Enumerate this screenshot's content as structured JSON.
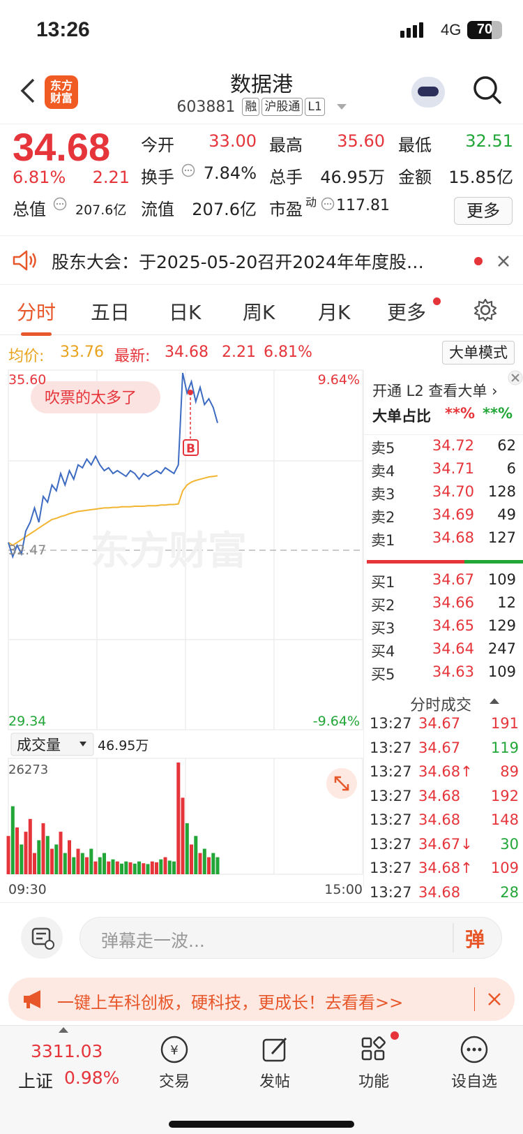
{
  "status": {
    "time": "13:26",
    "network": "4G",
    "battery": "70"
  },
  "header": {
    "title": "数据港",
    "code": "603881",
    "tags": [
      "融",
      "沪股通",
      "L1"
    ],
    "logo": "东方财富"
  },
  "quote": {
    "price": "34.68",
    "pct": "6.81%",
    "change": "2.21",
    "open_label": "今开",
    "open": "33.00",
    "high_label": "最高",
    "high": "35.60",
    "low_label": "最低",
    "low": "32.51",
    "turnover_label": "换手",
    "turnover": "7.84%",
    "vol_label": "总手",
    "vol": "46.95万",
    "amount_label": "金额",
    "amount": "15.85亿",
    "mcap_label": "总值",
    "mcap": "207.6亿",
    "float_label": "流值",
    "float": "207.6亿",
    "pe_label": "市盈",
    "pe_sup": "动",
    "pe": "117.81",
    "more": "更多"
  },
  "notice": {
    "text": "股东大会：于2025-05-20召开2024年年度股…"
  },
  "tabs": [
    "分时",
    "五日",
    "日K",
    "周K",
    "月K",
    "更多"
  ],
  "pricebar": {
    "avg_label": "均价:",
    "avg": "33.76",
    "latest_label": "最新:",
    "latest": "34.68",
    "change": "2.21",
    "pct": "6.81%",
    "mode_btn": "大单模式"
  },
  "chart": {
    "top": "35.60",
    "top_pct": "9.64%",
    "bottom": "29.34",
    "bottom_pct": "-9.64%",
    "prev": "32.47",
    "bubble": "吹票的太多了",
    "b_marker": "B",
    "watermark": "东方财富",
    "vol_dropdown": "成交量",
    "vol_total": "46.95万",
    "vol_max": "26273",
    "start": "09:30",
    "end": "15:00"
  },
  "chart_data": {
    "type": "line",
    "ylim": [
      29.34,
      35.6
    ],
    "prev_close": 32.47,
    "price": [
      32.6,
      32.35,
      32.55,
      32.4,
      32.8,
      32.95,
      33.2,
      32.95,
      33.4,
      33.3,
      33.6,
      33.5,
      33.8,
      33.6,
      33.85,
      33.7,
      33.95,
      33.9,
      34.05,
      33.95,
      34.1,
      33.95,
      33.85,
      33.9,
      33.8,
      33.85,
      33.8,
      33.75,
      33.85,
      33.8,
      33.7,
      33.8,
      33.75,
      33.8,
      33.85,
      33.8,
      33.9,
      33.85,
      33.8,
      33.95,
      35.55,
      35.2,
      35.4,
      35.05,
      35.3,
      35.0,
      35.1,
      34.95,
      34.68
    ],
    "avg": [
      32.6,
      32.55,
      32.6,
      32.65,
      32.7,
      32.75,
      32.8,
      32.85,
      32.9,
      32.95,
      33.0,
      33.02,
      33.05,
      33.07,
      33.1,
      33.12,
      33.14,
      33.15,
      33.16,
      33.17,
      33.18,
      33.19,
      33.2,
      33.2,
      33.21,
      33.21,
      33.22,
      33.22,
      33.22,
      33.23,
      33.23,
      33.23,
      33.24,
      33.24,
      33.24,
      33.25,
      33.25,
      33.26,
      33.26,
      33.27,
      33.5,
      33.6,
      33.65,
      33.68,
      33.7,
      33.72,
      33.74,
      33.75,
      33.76
    ],
    "volume": [
      9000,
      16000,
      11000,
      7000,
      10000,
      13000,
      5000,
      8000,
      12000,
      9000,
      6000,
      7000,
      10000,
      5000,
      8000,
      4000,
      6000,
      5000,
      4000,
      6000,
      3000,
      4000,
      5000,
      3000,
      3500,
      3000,
      2500,
      3000,
      2800,
      2500,
      3000,
      2600,
      2400,
      3000,
      2800,
      3500,
      4000,
      3200,
      3000,
      26273,
      18000,
      12000,
      7000,
      9000,
      5000,
      6000,
      4000,
      5000,
      4000
    ]
  },
  "bigorder": {
    "open_l2": "开通 L2 查看大单",
    "share_label": "大单占比",
    "buy": "**%",
    "sell": "**%"
  },
  "asks": [
    {
      "k": "卖5",
      "p": "34.72",
      "v": "62"
    },
    {
      "k": "卖4",
      "p": "34.71",
      "v": "6"
    },
    {
      "k": "卖3",
      "p": "34.70",
      "v": "128"
    },
    {
      "k": "卖2",
      "p": "34.69",
      "v": "49"
    },
    {
      "k": "卖1",
      "p": "34.68",
      "v": "127"
    }
  ],
  "bids": [
    {
      "k": "买1",
      "p": "34.67",
      "v": "109"
    },
    {
      "k": "买2",
      "p": "34.66",
      "v": "12"
    },
    {
      "k": "买3",
      "p": "34.65",
      "v": "129"
    },
    {
      "k": "买4",
      "p": "34.64",
      "v": "247"
    },
    {
      "k": "买5",
      "p": "34.63",
      "v": "109"
    }
  ],
  "trades_title": "分时成交",
  "trades": [
    {
      "t": "13:27",
      "p": "34.67",
      "v": "191"
    },
    {
      "t": "13:27",
      "p": "34.67",
      "v": "119"
    },
    {
      "t": "13:27",
      "p": "34.68↑",
      "v": "89"
    },
    {
      "t": "13:27",
      "p": "34.68",
      "v": "192"
    },
    {
      "t": "13:27",
      "p": "34.68",
      "v": "148"
    },
    {
      "t": "13:27",
      "p": "34.67↓",
      "v": "30"
    },
    {
      "t": "13:27",
      "p": "34.68↑",
      "v": "109"
    },
    {
      "t": "13:27",
      "p": "34.68",
      "v": "28"
    }
  ],
  "danmu": {
    "placeholder": "弹幕走一波...",
    "btn": "弹"
  },
  "ad": {
    "text": "一键上车科创板，硬科技，更成长！去看看>>"
  },
  "bottom": {
    "index_value": "3311.03",
    "index_name": "上证",
    "index_pct": "0.98%",
    "trade": "交易",
    "post": "发帖",
    "func": "功能",
    "watch": "设自选"
  }
}
